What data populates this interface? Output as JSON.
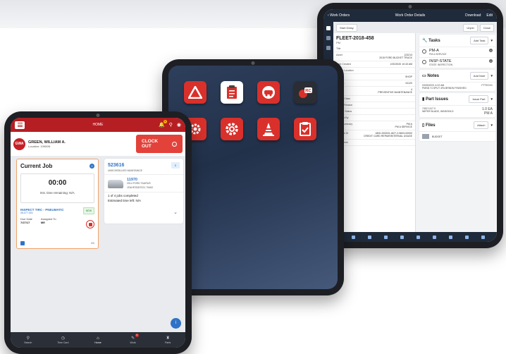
{
  "right_tablet": {
    "header": {
      "back": "Work Orders",
      "title": "Work Order Details",
      "action1": "Download",
      "action2": "Edit"
    },
    "toolbar": {
      "start_delay": "Start Delay",
      "btn1": "Unpin",
      "btn2": "Close"
    },
    "wo": {
      "id": "FLEET-2018-458",
      "sub": "PM"
    },
    "fields": [
      {
        "label": "Title",
        "value": ""
      },
      {
        "label": "Asset",
        "value": "123213\n2015 FORD BUCKET TRUCK"
      },
      {
        "label": "Date Created",
        "value": "2/20/2020 10:43 AM"
      },
      {
        "label": "Repair Location",
        "value": ""
      },
      {
        "label": "Shop",
        "value": "SHOP"
      },
      {
        "label": "Meter 1",
        "value": "61120"
      },
      {
        "label": "Priority",
        "value": "4\nPREVENTIVE MAINTENANCE"
      },
      {
        "label": "Repair Class",
        "value": ""
      },
      {
        "label": "Repair Reason",
        "value": ""
      },
      {
        "label": "Vehicle Status",
        "value": ""
      },
      {
        "label": "Created By",
        "value": ""
      },
      {
        "label": "Task Summary",
        "value": "PM A\nPM A SERVICE"
      },
      {
        "label": "Account ID",
        "value": "1800-333333-1827-2-5603-00000\nCREDIT CARD REPAIR/INTERNAL USAGE"
      },
      {
        "label": "Comments",
        "value": ""
      }
    ],
    "tasks": {
      "title": "Tasks",
      "btn": "Add Task",
      "items": [
        {
          "name": "PM-A",
          "desc": "PM A SERVICE"
        },
        {
          "name": "INSP-STATE",
          "desc": "STATE INSPECTION"
        }
      ]
    },
    "notes": {
      "title": "Notes",
      "btn": "Add Note",
      "date": "03/09/2021 4:22 AM",
      "text": "PMSB 74 SPUT 4FA BRNDN FINISHED",
      "who": "FTTECH1"
    },
    "parts": {
      "title": "Part Issues",
      "btn": "Issue Part",
      "part": "7402 1117 0",
      "desc": "WIPER BLADE, WINDSHLD",
      "qty": "1.0 EA",
      "task": "PM A"
    },
    "files": {
      "title": "Files",
      "btn": "Attach",
      "item": "BUDGET"
    }
  },
  "left_tablet": {
    "header": {
      "title": "HOME",
      "badge": "3"
    },
    "user": {
      "initials": "GWA",
      "name": "GREEN, WILLIAM A.",
      "location": "Location: 10900N",
      "clock_out": "CLOCK OUT"
    },
    "current_job": {
      "title": "Current Job",
      "count": "0",
      "time": "00:00",
      "remaining": "Est. time remaining: N/A",
      "code": "INSPECT TIRC - PNEUMATIC",
      "code_date": "05-077-001",
      "status": "NEW",
      "due_label": "Due Date",
      "due": "7/27/17",
      "assigned_label": "Assigned To",
      "assigned": "ME",
      "footer": "0/0"
    },
    "work_order": {
      "id": "523616",
      "badge": "5",
      "schedule": "UNSCHEDULED MAINTAINCE",
      "vehicle_id": "11970",
      "vehicle_desc": "2014 FORD TAURUS",
      "vin": "1FAHP2D87EG1 75452",
      "jobs": "1 of 4 jobs completed",
      "est": "Estimated time left: N/A"
    },
    "nav": [
      {
        "label": "Search",
        "icon": "search-icon"
      },
      {
        "label": "Time Card",
        "icon": "clock-icon"
      },
      {
        "label": "Home",
        "icon": "home-icon"
      },
      {
        "label": "Work",
        "icon": "wrench-icon",
        "badge": "3"
      },
      {
        "label": "Parts",
        "icon": "parts-icon"
      }
    ]
  },
  "colors": {
    "brand_red": "#b51e22",
    "accent_blue": "#2f73c6",
    "navy": "#1f2a3a"
  }
}
